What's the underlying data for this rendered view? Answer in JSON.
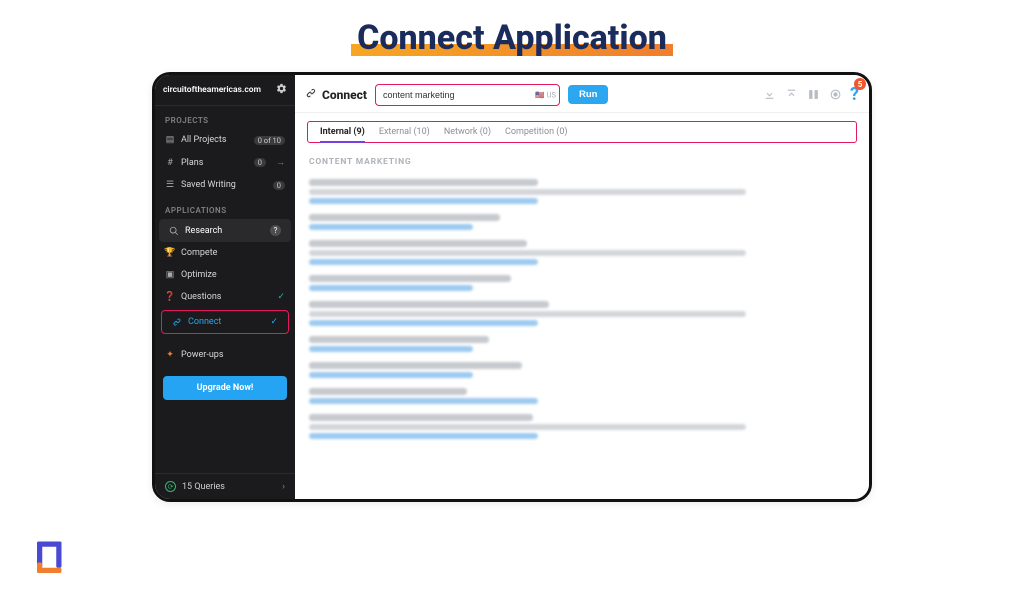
{
  "page_title": "Connect Application",
  "sidebar": {
    "domain": "circuitoftheamericas.com",
    "sections": {
      "projects_label": "PROJECTS",
      "applications_label": "APPLICATIONS"
    },
    "projects": {
      "all_label": "All Projects",
      "all_count": "0 of 10",
      "plans_label": "Plans",
      "plans_count": "0",
      "saved_label": "Saved Writing",
      "saved_count": "0"
    },
    "apps": {
      "research": "Research",
      "compete": "Compete",
      "optimize": "Optimize",
      "questions": "Questions",
      "connect": "Connect",
      "powerups": "Power-ups"
    },
    "upgrade_label": "Upgrade Now!",
    "queries_label": "15 Queries"
  },
  "header": {
    "title": "Connect",
    "search_value": "content marketing",
    "locale": "US",
    "run_label": "Run",
    "notif_count": "5"
  },
  "tabs": [
    {
      "label": "Internal (9)",
      "active": true
    },
    {
      "label": "External (10)",
      "active": false
    },
    {
      "label": "Network (0)",
      "active": false
    },
    {
      "label": "Competition (0)",
      "active": false
    }
  ],
  "section_heading": "CONTENT MARKETING",
  "results_count": 9
}
